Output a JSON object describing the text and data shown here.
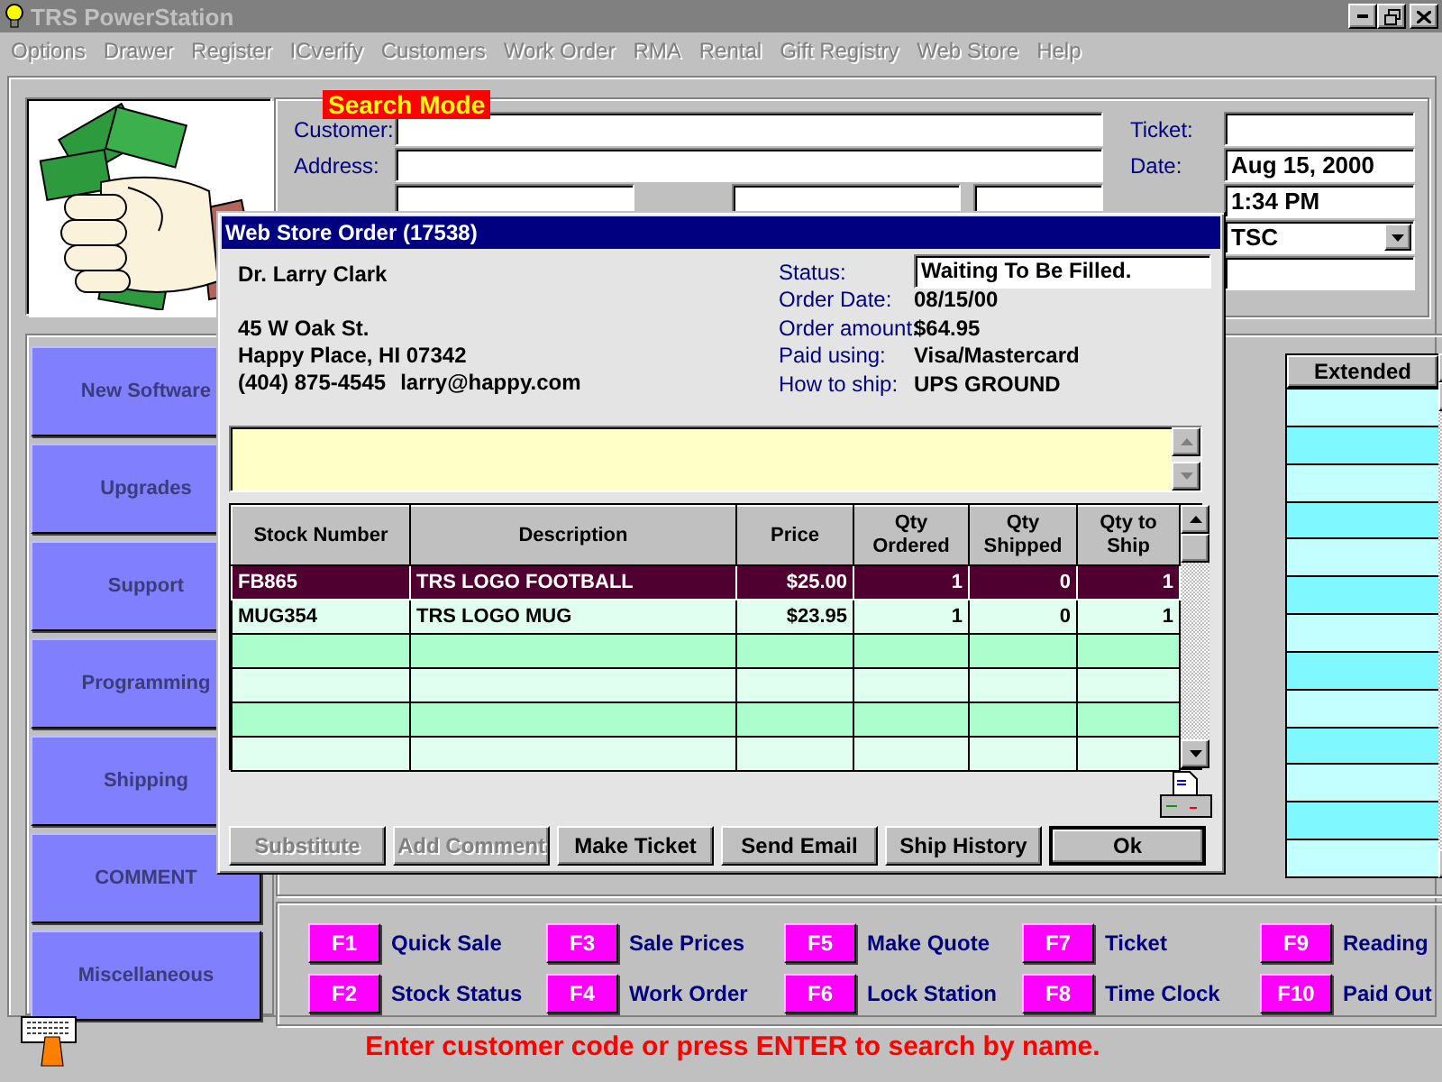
{
  "window": {
    "title": "TRS PowerStation"
  },
  "menu": [
    {
      "label": "Options",
      "disabled": true
    },
    {
      "label": "Drawer",
      "disabled": true
    },
    {
      "label": "Register",
      "disabled": true
    },
    {
      "label": "ICverify",
      "disabled": true
    },
    {
      "label": "Customers",
      "disabled": true
    },
    {
      "label": "Work Order",
      "disabled": true
    },
    {
      "label": "RMA",
      "disabled": true
    },
    {
      "label": "Rental",
      "disabled": true
    },
    {
      "label": "Gift Registry",
      "disabled": true
    },
    {
      "label": "Web Store",
      "disabled": true
    },
    {
      "label": "Help",
      "disabled": true
    }
  ],
  "search": {
    "mode_badge": "Search Mode",
    "left_fields": [
      {
        "label": "Customer:"
      },
      {
        "label": "Address:"
      }
    ],
    "right_fields": [
      {
        "label": "Ticket:",
        "kind": "text"
      },
      {
        "label": "Date:",
        "value": "Aug 15, 2000",
        "kind": "text"
      },
      {
        "value": "1:34 PM",
        "kind": "text"
      },
      {
        "value": "TSC",
        "kind": "dropdown"
      },
      {
        "kind": "text"
      }
    ]
  },
  "side_buttons": [
    {
      "label": "New Software",
      "disabled": true
    },
    {
      "label": "Upgrades",
      "disabled": true
    },
    {
      "label": "Support",
      "disabled": true
    },
    {
      "label": "Programming",
      "disabled": true
    },
    {
      "label": "Shipping",
      "disabled": true
    },
    {
      "label": "COMMENT",
      "disabled": true
    },
    {
      "label": "Miscellaneous",
      "disabled": true
    }
  ],
  "line_grid": {
    "columns": [
      "Extended"
    ]
  },
  "function_keys": [
    {
      "key": "F1",
      "label": "Quick Sale"
    },
    {
      "key": "F2",
      "label": "Stock Status"
    },
    {
      "key": "F3",
      "label": "Sale Prices"
    },
    {
      "key": "F4",
      "label": "Work Order"
    },
    {
      "key": "F5",
      "label": "Make Quote"
    },
    {
      "key": "F6",
      "label": "Lock Station"
    },
    {
      "key": "F7",
      "label": "Ticket"
    },
    {
      "key": "F8",
      "label": "Time Clock"
    },
    {
      "key": "F9",
      "label": "Reading"
    },
    {
      "key": "F10",
      "label": "Paid Out"
    }
  ],
  "status_message": "Enter customer code or press ENTER to search by name.",
  "dialog": {
    "title": "Web Store Order (17538)",
    "customer": {
      "name": "Dr. Larry Clark",
      "address_lines": [
        "45 W Oak St.",
        "Happy Place, HI 07342"
      ],
      "phone": "(404) 875-4545",
      "email": "larry@happy.com"
    },
    "details": [
      {
        "label": "Status:",
        "value": "Waiting To Be Filled.",
        "kind": "field"
      },
      {
        "label": "Order Date:",
        "value": "08/15/00",
        "kind": "text"
      },
      {
        "label": "Order amount:",
        "value": "$64.95",
        "kind": "text"
      },
      {
        "label": "Paid using:",
        "value": "Visa/Mastercard",
        "kind": "text"
      },
      {
        "label": "How to ship:",
        "value": "UPS GROUND",
        "kind": "text"
      }
    ],
    "grid": {
      "columns": [
        "Stock Number",
        "Description",
        "Price",
        "Qty Ordered",
        "Qty Shipped",
        "Qty to Ship"
      ],
      "rows": [
        {
          "cells": [
            "FB865",
            "TRS LOGO FOOTBALL",
            "$25.00",
            "1",
            "0",
            "1"
          ],
          "selected": true
        },
        {
          "cells": [
            "MUG354",
            "TRS LOGO MUG",
            "$23.95",
            "1",
            "0",
            "1"
          ],
          "selected": false
        }
      ]
    },
    "buttons": [
      {
        "label": "Substitute",
        "disabled": true,
        "default": false
      },
      {
        "label": "Add Comment",
        "disabled": true,
        "default": false
      },
      {
        "label": "Make Ticket",
        "disabled": false,
        "default": false
      },
      {
        "label": "Send Email",
        "disabled": false,
        "default": false
      },
      {
        "label": "Ship History",
        "disabled": false,
        "default": false
      },
      {
        "label": "Ok",
        "disabled": false,
        "default": true
      }
    ]
  }
}
